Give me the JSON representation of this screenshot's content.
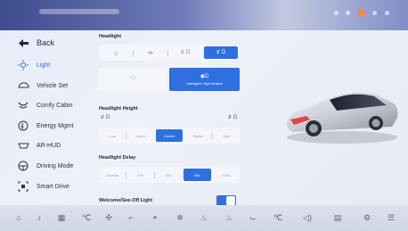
{
  "sidebar": {
    "back_label": "Back",
    "items": [
      {
        "label": "Light",
        "icon": "light-icon"
      },
      {
        "label": "Vehicle Set",
        "icon": "car-outline-icon"
      },
      {
        "label": "Comfy Cabin",
        "icon": "comfort-icon"
      },
      {
        "label": "Energy Mgmt",
        "icon": "energy-icon"
      },
      {
        "label": "AR-HUD",
        "icon": "hud-icon"
      },
      {
        "label": "Driving Mode",
        "icon": "steering-icon"
      },
      {
        "label": "Smart Drive",
        "icon": "smart-drive-icon"
      }
    ],
    "active_index": 0
  },
  "headlight": {
    "title": "Headlight",
    "selected_index": 3,
    "buttons": [
      {
        "label": "",
        "label2": ""
      },
      {
        "label": "",
        "label2": "Intelligent High Beams"
      }
    ]
  },
  "headlight_height": {
    "title": "Headlight Height",
    "options": [
      "Low",
      "Lower",
      "Centre",
      "Higher",
      "High"
    ],
    "selected_index": 2
  },
  "headlight_delay": {
    "title": "Headlight Delay",
    "options": [
      "Disable",
      "10s",
      "30s",
      "60s",
      "120s"
    ],
    "selected_index": 3
  },
  "welcome": {
    "title": "Welcome/See-Off Light",
    "enabled": true
  },
  "colors": {
    "accent": "#2f6fe0",
    "topbar": "#3e4c8e"
  }
}
